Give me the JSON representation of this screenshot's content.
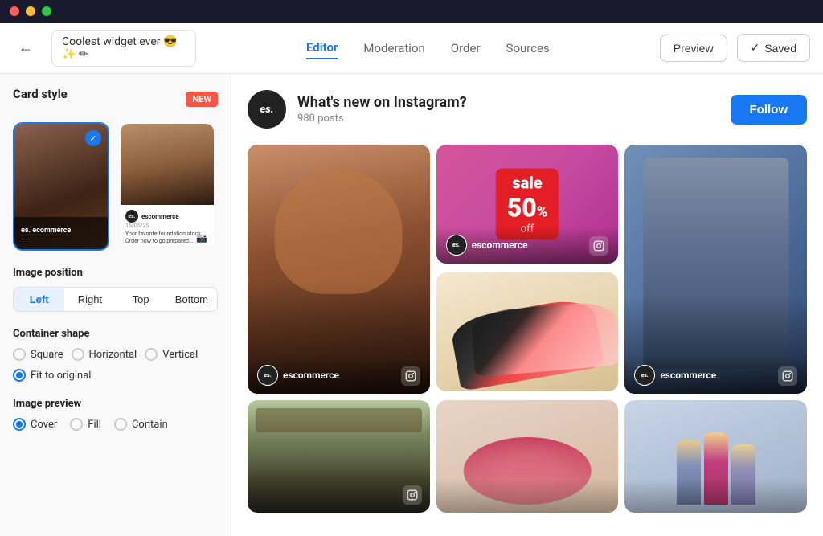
{
  "window": {
    "title": "Coolest widget ever"
  },
  "topbar": {
    "back_label": "←",
    "widget_name": "Coolest widget ever 😎✨ ✏",
    "tabs": [
      {
        "id": "editor",
        "label": "Editor",
        "active": true
      },
      {
        "id": "moderation",
        "label": "Moderation",
        "active": false
      },
      {
        "id": "order",
        "label": "Order",
        "active": false
      },
      {
        "id": "sources",
        "label": "Sources",
        "active": false
      }
    ],
    "preview_label": "Preview",
    "saved_label": "Saved",
    "saved_check": "✓"
  },
  "sidebar": {
    "card_style_title": "Card style",
    "new_badge": "NEW",
    "image_position_title": "Image position",
    "position_options": [
      "Left",
      "Right",
      "Top",
      "Bottom"
    ],
    "active_position": "Left",
    "container_shape_title": "Container shape",
    "shape_options": [
      "Square",
      "Horizontal",
      "Vertical",
      "Fit to original"
    ],
    "active_shape": "Fit to original",
    "image_preview_title": "Image preview",
    "preview_options": [
      "Cover",
      "Fill",
      "Contain"
    ],
    "active_preview": "Cover"
  },
  "feed": {
    "avatar_text": "es.",
    "title": "What's new on Instagram?",
    "post_count": "980 posts",
    "follow_label": "Follow"
  },
  "photos": [
    {
      "id": "portrait-main",
      "type": "portrait",
      "size": "large",
      "username": "escommerce",
      "platform": "instagram"
    },
    {
      "id": "sale",
      "type": "sale",
      "size": "small",
      "username": "escommerce",
      "platform": "instagram"
    },
    {
      "id": "shoes",
      "type": "shoes",
      "size": "small",
      "username": "",
      "platform": ""
    },
    {
      "id": "fashion",
      "type": "fashion",
      "size": "large",
      "username": "escommerce",
      "platform": "instagram"
    },
    {
      "id": "flowers",
      "type": "flowers",
      "size": "small",
      "username": "",
      "platform": ""
    },
    {
      "id": "group",
      "type": "group",
      "size": "small",
      "username": "",
      "platform": ""
    },
    {
      "id": "store",
      "type": "store",
      "size": "bottom-large",
      "username": "",
      "platform": "instagram"
    }
  ],
  "sale_card": {
    "text": "sale",
    "percent": "50",
    "suffix": "%",
    "off": "off"
  },
  "card_preview_1": {
    "label": "es. ecommerce",
    "type": "dark-portrait"
  },
  "card_preview_2": {
    "name": "escommerce",
    "date": "15/05/25",
    "text": "Your favorite foundation stock. Order now to go prepared..."
  }
}
